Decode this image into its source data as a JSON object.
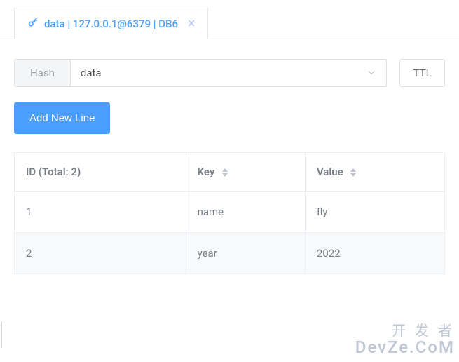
{
  "tab": {
    "label": "data | 127.0.0.1@6379 | DB6"
  },
  "type_badge": "Hash",
  "key_name": "data",
  "ttl_label": "TTL",
  "add_button_label": "Add New Line",
  "table": {
    "total_count": 2,
    "id_header": "ID (Total: 2)",
    "key_header": "Key",
    "value_header": "Value",
    "rows": [
      {
        "id": "1",
        "key": "name",
        "value": "fly"
      },
      {
        "id": "2",
        "key": "year",
        "value": "2022"
      }
    ]
  },
  "watermark": {
    "line1": "开 发 者",
    "line2": "DevZe.CoM"
  }
}
